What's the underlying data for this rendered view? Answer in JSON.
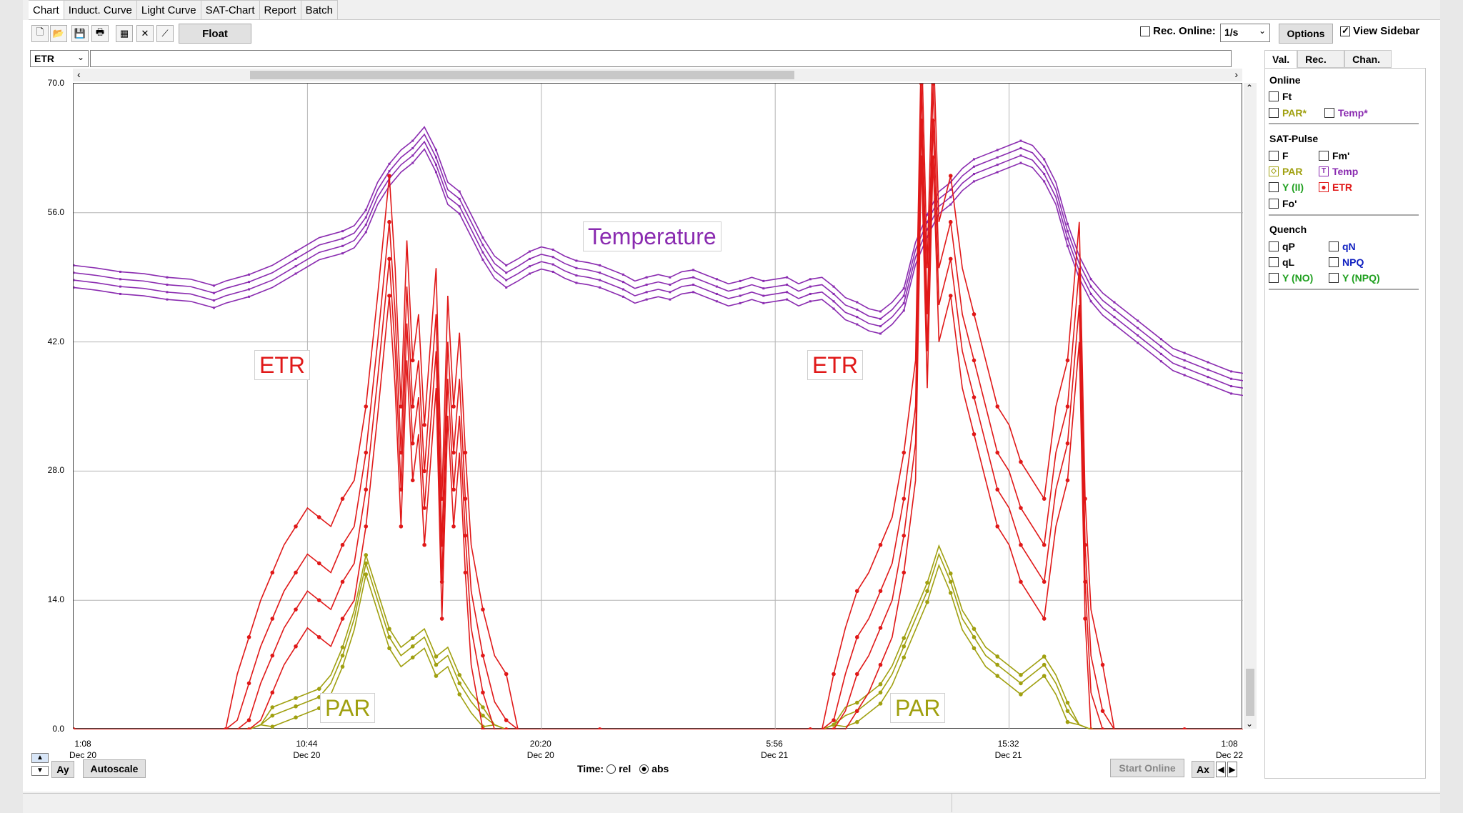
{
  "tabs": [
    {
      "label": "Chart",
      "active": true
    },
    {
      "label": "Induct. Curve"
    },
    {
      "label": "Light Curve"
    },
    {
      "label": "SAT-Chart"
    },
    {
      "label": "Report"
    },
    {
      "label": "Batch"
    }
  ],
  "toolbar": {
    "float_label": "Float",
    "icons": [
      "new-file-icon",
      "open-folder-icon",
      "save-icon",
      "print-icon",
      "grid-icon",
      "cross-cursor-icon",
      "line-icon"
    ]
  },
  "top_right": {
    "rec_online_label": "Rec. Online:",
    "rec_online_checked": false,
    "interval_value": "1/s",
    "options_label": "Options",
    "view_sidebar_label": "View Sidebar",
    "view_sidebar_checked": true
  },
  "channel_select": {
    "value": "ETR"
  },
  "status_line": {
    "value": ""
  },
  "chart_data": {
    "type": "line",
    "ylim": [
      0,
      70
    ],
    "yticks": [
      "0.0",
      "14.0",
      "28.0",
      "42.0",
      "56.0",
      "70.0"
    ],
    "xticks": [
      {
        "time": "1:08",
        "date": "Dec 20"
      },
      {
        "time": "10:44",
        "date": "Dec 20"
      },
      {
        "time": "20:20",
        "date": "Dec 20"
      },
      {
        "time": "5:56",
        "date": "Dec 21"
      },
      {
        "time": "15:32",
        "date": "Dec 21"
      },
      {
        "time": "1:08",
        "date": "Dec 22"
      }
    ],
    "grid": true,
    "colors": {
      "temperature": "#8a2bb0",
      "etr": "#e01818",
      "par": "#a0a010"
    },
    "annotations": {
      "temperature": "Temperature",
      "etr_1": "ETR",
      "etr_2": "ETR",
      "par_1": "PAR",
      "par_2": "PAR"
    },
    "temperature_series": [
      [
        0,
        49.5
      ],
      [
        2,
        49.2
      ],
      [
        4,
        48.8
      ],
      [
        6,
        48.6
      ],
      [
        8,
        48.2
      ],
      [
        10,
        48.0
      ],
      [
        12,
        47.3
      ],
      [
        13,
        47.8
      ],
      [
        15,
        48.5
      ],
      [
        17,
        49.5
      ],
      [
        19,
        51.0
      ],
      [
        21,
        52.5
      ],
      [
        23,
        53.2
      ],
      [
        24,
        53.8
      ],
      [
        25,
        55.5
      ],
      [
        26,
        58.5
      ],
      [
        27,
        60.5
      ],
      [
        28,
        62.0
      ],
      [
        29,
        63.0
      ],
      [
        30,
        64.5
      ],
      [
        31,
        62.0
      ],
      [
        32,
        58.5
      ],
      [
        33,
        57.5
      ],
      [
        34,
        55.0
      ],
      [
        35,
        52.5
      ],
      [
        36,
        50.5
      ],
      [
        37,
        49.5
      ],
      [
        38,
        50.2
      ],
      [
        39,
        51.0
      ],
      [
        40,
        51.5
      ],
      [
        41,
        51.2
      ],
      [
        42,
        50.5
      ],
      [
        43,
        50.0
      ],
      [
        44,
        49.8
      ],
      [
        45,
        49.5
      ],
      [
        46,
        49.0
      ],
      [
        47,
        48.5
      ],
      [
        48,
        47.8
      ],
      [
        49,
        48.2
      ],
      [
        50,
        48.5
      ],
      [
        51,
        48.2
      ],
      [
        52,
        48.8
      ],
      [
        53,
        49.0
      ],
      [
        54,
        48.5
      ],
      [
        55,
        48.0
      ],
      [
        56,
        47.5
      ],
      [
        57,
        47.8
      ],
      [
        58,
        48.2
      ],
      [
        59,
        47.8
      ],
      [
        60,
        48.0
      ],
      [
        61,
        48.2
      ],
      [
        62,
        47.5
      ],
      [
        63,
        48.0
      ],
      [
        64,
        48.2
      ],
      [
        65,
        47.2
      ],
      [
        66,
        46.0
      ],
      [
        67,
        45.5
      ],
      [
        68,
        44.8
      ],
      [
        69,
        44.5
      ],
      [
        70,
        45.5
      ],
      [
        71,
        47.0
      ],
      [
        72,
        52.0
      ],
      [
        73,
        55.0
      ],
      [
        74,
        57.5
      ],
      [
        75,
        58.5
      ],
      [
        76,
        60.0
      ],
      [
        77,
        61.0
      ],
      [
        78,
        61.5
      ],
      [
        79,
        62.0
      ],
      [
        80,
        62.5
      ],
      [
        81,
        63.0
      ],
      [
        82,
        62.5
      ],
      [
        83,
        61.0
      ],
      [
        84,
        58.5
      ],
      [
        85,
        54.0
      ],
      [
        86,
        50.5
      ],
      [
        87,
        48.0
      ],
      [
        88,
        46.5
      ],
      [
        89,
        45.5
      ],
      [
        90,
        44.5
      ],
      [
        91,
        43.5
      ],
      [
        92,
        42.5
      ],
      [
        93,
        41.5
      ],
      [
        94,
        40.5
      ],
      [
        95,
        40.0
      ],
      [
        96,
        39.5
      ],
      [
        97,
        39.0
      ],
      [
        98,
        38.5
      ],
      [
        99,
        38.0
      ],
      [
        100,
        37.8
      ]
    ],
    "etr_series": [
      [
        0,
        0
      ],
      [
        10,
        0
      ],
      [
        13,
        0
      ],
      [
        14,
        1
      ],
      [
        15,
        5
      ],
      [
        16,
        9
      ],
      [
        17,
        12
      ],
      [
        18,
        15
      ],
      [
        19,
        17
      ],
      [
        20,
        19
      ],
      [
        21,
        18
      ],
      [
        22,
        17
      ],
      [
        23,
        20
      ],
      [
        24,
        22
      ],
      [
        25,
        30
      ],
      [
        26,
        42
      ],
      [
        27,
        55
      ],
      [
        27.5,
        45
      ],
      [
        28,
        30
      ],
      [
        28.5,
        48
      ],
      [
        29,
        35
      ],
      [
        29.5,
        40
      ],
      [
        30,
        28
      ],
      [
        31,
        45
      ],
      [
        31.5,
        20
      ],
      [
        32,
        42
      ],
      [
        32.5,
        30
      ],
      [
        33,
        38
      ],
      [
        33.5,
        25
      ],
      [
        34,
        15
      ],
      [
        35,
        8
      ],
      [
        36,
        3
      ],
      [
        37,
        1
      ],
      [
        38,
        0
      ],
      [
        45,
        0
      ],
      [
        55,
        0
      ],
      [
        63,
        0
      ],
      [
        64,
        0
      ],
      [
        65,
        1
      ],
      [
        66,
        6
      ],
      [
        67,
        10
      ],
      [
        68,
        12
      ],
      [
        69,
        15
      ],
      [
        70,
        18
      ],
      [
        71,
        25
      ],
      [
        72,
        35
      ],
      [
        72.5,
        70
      ],
      [
        73,
        45
      ],
      [
        73.5,
        70
      ],
      [
        74,
        50
      ],
      [
        75,
        55
      ],
      [
        76,
        45
      ],
      [
        77,
        40
      ],
      [
        78,
        35
      ],
      [
        79,
        30
      ],
      [
        80,
        28
      ],
      [
        81,
        24
      ],
      [
        82,
        22
      ],
      [
        83,
        20
      ],
      [
        84,
        30
      ],
      [
        85,
        35
      ],
      [
        86,
        50
      ],
      [
        86.5,
        20
      ],
      [
        87,
        8
      ],
      [
        88,
        2
      ],
      [
        89,
        0
      ],
      [
        95,
        0
      ],
      [
        100,
        0
      ]
    ],
    "par_series": [
      [
        0,
        0
      ],
      [
        14,
        0
      ],
      [
        15,
        0
      ],
      [
        16,
        0.5
      ],
      [
        17,
        1.5
      ],
      [
        18,
        2
      ],
      [
        19,
        2.5
      ],
      [
        20,
        3
      ],
      [
        21,
        3.5
      ],
      [
        22,
        5
      ],
      [
        23,
        8
      ],
      [
        24,
        12
      ],
      [
        25,
        18
      ],
      [
        26,
        14
      ],
      [
        27,
        10
      ],
      [
        28,
        8
      ],
      [
        29,
        9
      ],
      [
        30,
        10
      ],
      [
        31,
        7
      ],
      [
        32,
        8
      ],
      [
        33,
        5
      ],
      [
        34,
        3
      ],
      [
        35,
        1.5
      ],
      [
        36,
        0.5
      ],
      [
        37,
        0
      ],
      [
        45,
        0
      ],
      [
        63,
        0
      ],
      [
        64,
        0
      ],
      [
        65,
        0.5
      ],
      [
        66,
        1.5
      ],
      [
        67,
        2
      ],
      [
        68,
        3
      ],
      [
        69,
        4
      ],
      [
        70,
        6
      ],
      [
        71,
        9
      ],
      [
        72,
        12
      ],
      [
        73,
        15
      ],
      [
        74,
        19
      ],
      [
        75,
        16
      ],
      [
        76,
        12
      ],
      [
        77,
        10
      ],
      [
        78,
        8
      ],
      [
        79,
        7
      ],
      [
        80,
        6
      ],
      [
        81,
        5
      ],
      [
        82,
        6
      ],
      [
        83,
        7
      ],
      [
        84,
        5
      ],
      [
        85,
        2
      ],
      [
        86,
        0.5
      ],
      [
        87,
        0
      ],
      [
        100,
        0
      ]
    ]
  },
  "axis_controls": {
    "ay_label": "Ay",
    "autoscale_label": "Autoscale",
    "time_label": "Time:",
    "rel_label": "rel",
    "abs_label": "abs",
    "time_mode": "abs",
    "start_online_label": "Start Online",
    "ax_label": "Ax"
  },
  "sidebar": {
    "tabs": [
      {
        "label": "Val.",
        "active": true
      },
      {
        "label": "Rec."
      },
      {
        "label": "Chan."
      }
    ],
    "sections": [
      {
        "title": "Online",
        "items": [
          {
            "label": "Ft",
            "color": "#000000",
            "checked": false
          },
          {
            "label": "PAR*",
            "color": "#a0a010",
            "checked": false
          },
          {
            "label": "Temp*",
            "color": "#8a2bb0",
            "checked": false
          }
        ]
      },
      {
        "title": "SAT-Pulse",
        "items": [
          {
            "label": "F",
            "color": "#000000",
            "checked": false
          },
          {
            "label": "Fm'",
            "color": "#000000",
            "checked": false
          },
          {
            "label": "PAR",
            "color": "#a0a010",
            "checked": true
          },
          {
            "label": "Temp",
            "color": "#8a2bb0",
            "checked": true
          },
          {
            "label": "Y (II)",
            "color": "#20a020",
            "checked": false
          },
          {
            "label": "ETR",
            "color": "#e01818",
            "checked": true
          },
          {
            "label": "Fo'",
            "color": "#000000",
            "checked": false
          }
        ]
      },
      {
        "title": "Quench",
        "items": [
          {
            "label": "qP",
            "color": "#000000",
            "checked": false
          },
          {
            "label": "qN",
            "color": "#1020c0",
            "checked": false
          },
          {
            "label": "qL",
            "color": "#000000",
            "checked": false
          },
          {
            "label": "NPQ",
            "color": "#1020c0",
            "checked": false
          },
          {
            "label": "Y (NO)",
            "color": "#20a020",
            "checked": false
          },
          {
            "label": "Y (NPQ)",
            "color": "#20a020",
            "checked": false
          }
        ]
      }
    ]
  }
}
